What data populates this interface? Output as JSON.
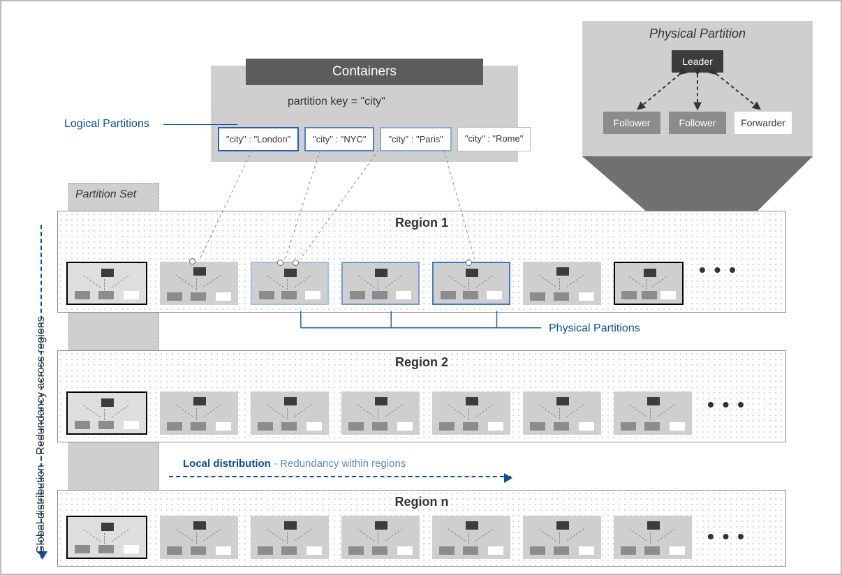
{
  "containers": {
    "header": "Containers",
    "partition_key_line": "partition key = \"city\"",
    "cities": [
      "\"city\" : \"London\"",
      "\"city\" : \"NYC\"",
      "\"city\" : \"Paris\"",
      "\"city\" : \"Rome\""
    ]
  },
  "labels": {
    "logical_partitions": "Logical Partitions",
    "partition_set": "Partition Set",
    "physical_partitions": "Physical Partitions",
    "more": "• • •"
  },
  "physical_partition": {
    "title": "Physical Partition",
    "leader": "Leader",
    "follower": "Follower",
    "forwarder": "Forwarder"
  },
  "regions": {
    "r1": "Region 1",
    "r2": "Region 2",
    "rn": "Region n"
  },
  "distribution": {
    "global_strong": "Global distribution",
    "global_sub": "  -  Redundancy across regions",
    "local_strong": "Local distribution",
    "local_sub": "  -  Redundancy within regions"
  },
  "colors": {
    "accent": "#0b4ea2",
    "panel": "#cfcfcf",
    "dark": "#3c3c3c"
  }
}
